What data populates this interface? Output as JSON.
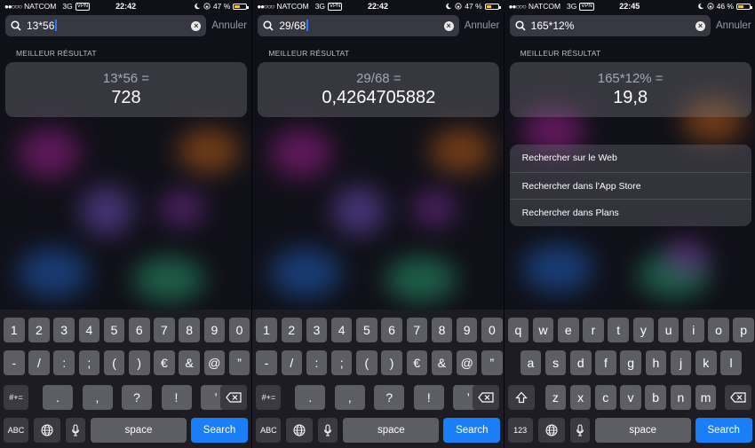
{
  "panels": [
    {
      "status": {
        "carrier": "NATCOM",
        "network": "3G",
        "vpn": "VPN",
        "time": "22:42",
        "battery": "47 %",
        "battery_level": 0.47
      },
      "search": {
        "query": "13*56",
        "cancel": "Annuler"
      },
      "section_label": "MEILLEUR RÉSULTAT",
      "result": {
        "expression": "13*56 =",
        "value": "728"
      },
      "keyboard": "numeric"
    },
    {
      "status": {
        "carrier": "NATCOM",
        "network": "3G",
        "vpn": "VPN",
        "time": "22:42",
        "battery": "47 %",
        "battery_level": 0.47
      },
      "search": {
        "query": "29/68",
        "cancel": "Annuler"
      },
      "section_label": "MEILLEUR RÉSULTAT",
      "result": {
        "expression": "29/68 =",
        "value": "0,4264705882"
      },
      "keyboard": "numeric"
    },
    {
      "status": {
        "carrier": "NATCOM",
        "network": "3G",
        "vpn": "VPN",
        "time": "22:45",
        "battery": "46 %",
        "battery_level": 0.46
      },
      "search": {
        "query": "165*12%",
        "cancel": "Annuler"
      },
      "section_label": "MEILLEUR RÉSULTAT",
      "result": {
        "expression": "165*12% =",
        "value": "19,8"
      },
      "suggestions": [
        "Rechercher sur le Web",
        "Rechercher dans l'App Store",
        "Rechercher dans Plans"
      ],
      "keyboard": "alpha"
    }
  ],
  "keyboards": {
    "numeric": {
      "row1": [
        "1",
        "2",
        "3",
        "4",
        "5",
        "6",
        "7",
        "8",
        "9",
        "0"
      ],
      "row2": [
        "-",
        "/",
        ":",
        ";",
        "(",
        ")",
        "€",
        "&",
        "@",
        "”"
      ],
      "row3_mode": "#+=",
      "row3": [
        ".",
        ",",
        "?",
        "!",
        "’"
      ],
      "bottom_mode": "ABC"
    },
    "alpha": {
      "row1": [
        "q",
        "w",
        "e",
        "r",
        "t",
        "y",
        "u",
        "i",
        "o",
        "p"
      ],
      "row2": [
        "a",
        "s",
        "d",
        "f",
        "g",
        "h",
        "j",
        "k",
        "l"
      ],
      "row3": [
        "z",
        "x",
        "c",
        "v",
        "b",
        "n",
        "m"
      ],
      "bottom_mode": "123"
    },
    "space_label": "space",
    "search_label": "Search",
    "icons": {
      "globe": "globe-icon",
      "mic": "microphone-icon",
      "shift": "shift-icon",
      "delete": "backspace-icon"
    }
  },
  "colors": {
    "accent": "#1a7ff7",
    "battery": "#f5c518"
  }
}
